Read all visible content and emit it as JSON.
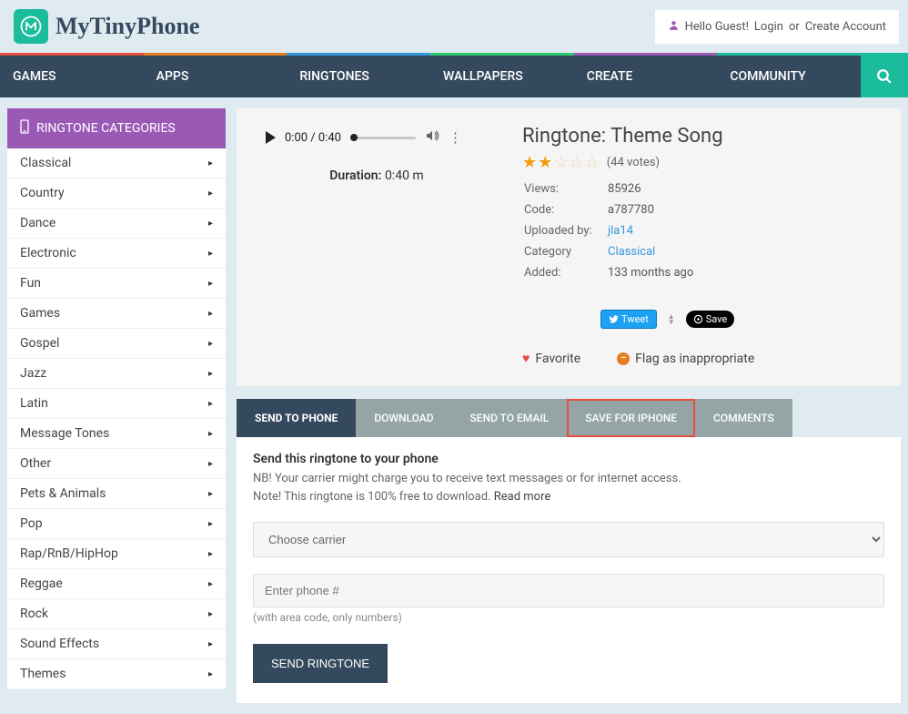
{
  "brand": "MyTinyPhone",
  "auth": {
    "greeting": "Hello Guest!",
    "login": "Login",
    "or": "or",
    "create": "Create Account"
  },
  "nav": {
    "games": "GAMES",
    "apps": "APPS",
    "ringtones": "RINGTONES",
    "wallpapers": "WALLPAPERS",
    "create": "CREATE",
    "community": "COMMUNITY"
  },
  "sidebar": {
    "header": "RINGTONE CATEGORIES",
    "items": [
      "Classical",
      "Country",
      "Dance",
      "Electronic",
      "Fun",
      "Games",
      "Gospel",
      "Jazz",
      "Latin",
      "Message Tones",
      "Other",
      "Pets & Animals",
      "Pop",
      "Rap/RnB/HipHop",
      "Reggae",
      "Rock",
      "Sound Effects",
      "Themes"
    ]
  },
  "player": {
    "time": "0:00 / 0:40",
    "duration_label": "Duration:",
    "duration_value": "0:40 m"
  },
  "ringtone": {
    "title": "Ringtone: Theme Song",
    "votes": "(44 votes)",
    "meta": {
      "views_label": "Views:",
      "views": "85926",
      "code_label": "Code:",
      "code": "a787780",
      "uploaded_by_label": "Uploaded by:",
      "uploaded_by": "jla14",
      "category_label": "Category",
      "category": "Classical",
      "added_label": "Added:",
      "added": "133 months ago"
    },
    "tweet": "Tweet",
    "save": "Save",
    "favorite": "Favorite",
    "flag": "Flag as inappropriate"
  },
  "tabs": {
    "send_to_phone": "SEND TO PHONE",
    "download": "DOWNLOAD",
    "send_to_email": "SEND TO EMAIL",
    "save_for_iphone": "SAVE FOR IPHONE",
    "comments": "COMMENTS"
  },
  "form": {
    "title": "Send this ringtone to your phone",
    "note1": "NB! Your carrier might charge you to receive text messages or for internet access.",
    "note2": "Note! This ringtone is 100% free to download. ",
    "read_more": "Read more",
    "carrier_placeholder": "Choose carrier",
    "phone_placeholder": "Enter phone #",
    "phone_hint": "(with area code, only numbers)",
    "send_button": "SEND RINGTONE"
  }
}
